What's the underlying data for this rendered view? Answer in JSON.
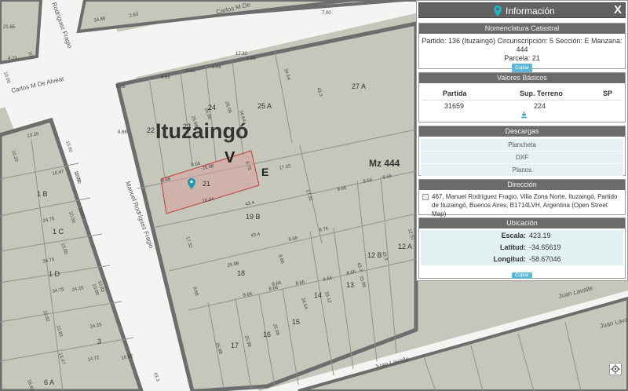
{
  "map": {
    "locality": "Ituzaingó",
    "circ": "V",
    "section": "E",
    "manzana": "Mz 444",
    "streets": [
      "Carlos M De Alvear",
      "Manuel Rodríguez Fragio",
      "Juan Lavalle",
      "Carlos M De",
      "Juan Lavalle",
      "Juan Lavalle",
      "Rodríguez Fragio"
    ],
    "parcels": [
      "21",
      "22",
      "23",
      "24",
      "25 A",
      "27 A",
      "19 B",
      "18",
      "17",
      "16",
      "15",
      "14",
      "13",
      "12 B",
      "12 A",
      "1 B",
      "1 C",
      "1 D",
      "3",
      "6 A"
    ],
    "dims": [
      "8.66",
      "8.66",
      "8.66",
      "8.66",
      "8.66",
      "17.32",
      "34.64",
      "43.3",
      "26.06",
      "26.06",
      "34.64",
      "25.98",
      "25.98",
      "8.75",
      "17.32",
      "26.04",
      "43.4",
      "17.32",
      "43.4",
      "25.98",
      "8.66",
      "8.66",
      "8.75",
      "17.32",
      "8.66",
      "8.66",
      "8.66",
      "8.66",
      "8.66",
      "8.66",
      "34.64",
      "33.12",
      "43.3",
      "33.09",
      "43.3",
      "25.98",
      "25.98",
      "25.98",
      "8.66",
      "8.66",
      "8.66",
      "8.66",
      "8.66",
      "8.66",
      "10.00",
      "10.00",
      "10.00",
      "10.00",
      "16.47",
      "24.75",
      "34.75",
      "34.75",
      "24.25",
      "24.25",
      "14.72",
      "10.82",
      "10.83",
      "10.82",
      "10.83",
      "13.47",
      "13.20",
      "10.20",
      "10.00",
      "10.00",
      "10.00",
      "19.57",
      "2.83",
      "34.86",
      "7.00",
      "4.23",
      "10",
      "21.65",
      "43.3",
      "16.83",
      "12.51",
      "8.66"
    ]
  },
  "panel": {
    "title": "Información",
    "close": "X",
    "catastral": {
      "header": "Nomenclatura Catastral",
      "line1": "Partido: 136 (Ituzaingó) Circunscripción: 5 Sección: E Manzana: 444",
      "line2": "Parcela: 21",
      "copy": "Copiar"
    },
    "basicos": {
      "header": "Valores Básicos",
      "col_partida": "Partida",
      "col_sup": "Sup. Terreno",
      "col_sp": "SP",
      "partida": "31659",
      "sup": "224",
      "sp": ""
    },
    "descargas": {
      "header": "Descargas",
      "items": [
        "Plancheta",
        "DXF",
        "Planos"
      ]
    },
    "direccion": {
      "header": "Dirección",
      "text": "467, Manuel Rodríguez Fragio, Villa Zona Norte, Ituzaingó, Partido de Ituzaingó, Buenos Aires, B1714LVH, Argentina (Open Street Map)"
    },
    "ubicacion": {
      "header": "Ubicación",
      "escala_label": "Escala:",
      "escala": "423.19",
      "lat_label": "Latitud:",
      "lat": "-34.65619",
      "lon_label": "Longitud:",
      "lon": "-58.67046",
      "copy": "Copiar"
    }
  },
  "colors": {
    "block": "#c4c7b9",
    "street": "#f4f4f2",
    "block_border": "#6d6d6d",
    "parcel_line": "#8f9190",
    "highlight": "#d9a3a0",
    "highlight_border": "#c0504d",
    "pin": "#1b9aa9",
    "panel_header": "#616161",
    "copy_button": "#5bb7d5"
  },
  "icons": [
    "marker-pin-icon",
    "close-icon",
    "download-icon",
    "locate-icon"
  ]
}
